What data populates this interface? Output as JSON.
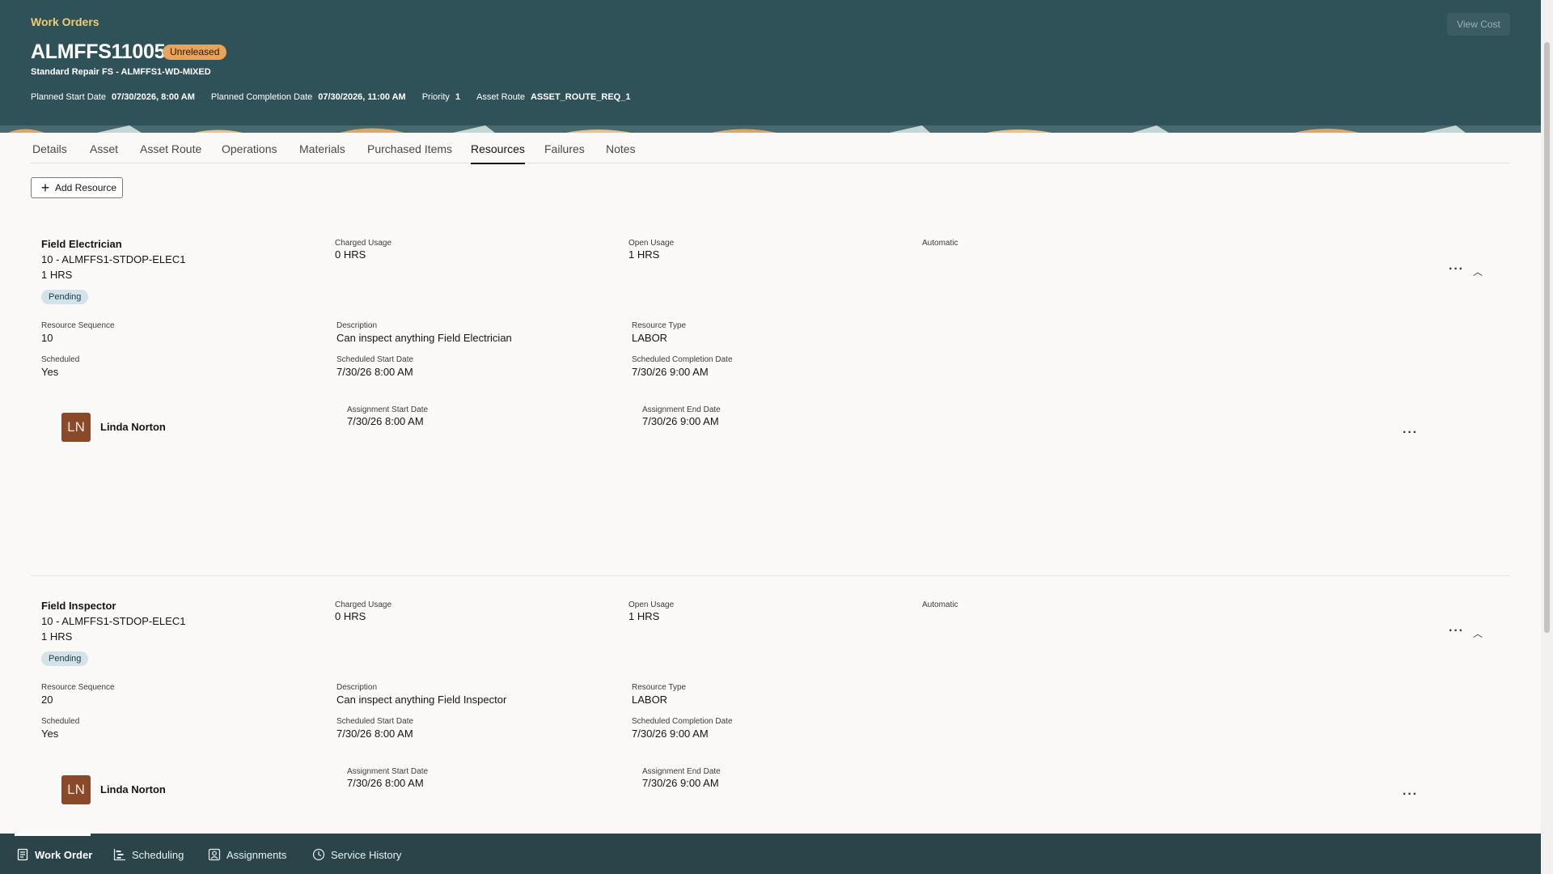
{
  "header": {
    "breadcrumb": "Work Orders",
    "title": "ALMFFS11005",
    "status": "Unreleased",
    "subtitle": "Standard Repair FS - ALMFFS1-WD-MIXED",
    "view_cost": "View Cost",
    "meta": [
      {
        "label": "Planned Start Date",
        "value": "07/30/2026, 8:00 AM"
      },
      {
        "label": "Planned Completion Date",
        "value": "07/30/2026, 11:00 AM"
      },
      {
        "label": "Priority",
        "value": "1"
      },
      {
        "label": "Asset Route",
        "value": "ASSET_ROUTE_REQ_1"
      }
    ]
  },
  "tabs": [
    "Details",
    "Asset",
    "Asset Route",
    "Operations",
    "Materials",
    "Purchased Items",
    "Resources",
    "Failures",
    "Notes"
  ],
  "active_tab": "Resources",
  "add_resource_label": "Add Resource",
  "resources": [
    {
      "name": "Field Electrician",
      "line1": "10 - ALMFFS1-STDOP-ELEC1",
      "line2": "1 HRS",
      "status": "Pending",
      "charged_usage_label": "Charged Usage",
      "charged_usage": "0 HRS",
      "open_usage_label": "Open Usage",
      "open_usage": "1 HRS",
      "automatic_label": "Automatic",
      "seq_label": "Resource Sequence",
      "seq": "10",
      "desc_label": "Description",
      "desc": "Can inspect anything Field Electrician",
      "type_label": "Resource Type",
      "type": "LABOR",
      "scheduled_label": "Scheduled",
      "scheduled": "Yes",
      "sched_start_label": "Scheduled Start Date",
      "sched_start": "7/30/26 8:00 AM",
      "sched_end_label": "Scheduled Completion Date",
      "sched_end": "7/30/26 9:00 AM",
      "assignee_initials": "LN",
      "assignee": "Linda Norton",
      "assign_start_label": "Assignment Start Date",
      "assign_start": "7/30/26 8:00 AM",
      "assign_end_label": "Assignment End Date",
      "assign_end": "7/30/26 9:00 AM"
    },
    {
      "name": "Field Inspector",
      "line1": "10 - ALMFFS1-STDOP-ELEC1",
      "line2": "1 HRS",
      "status": "Pending",
      "charged_usage_label": "Charged Usage",
      "charged_usage": "0 HRS",
      "open_usage_label": "Open Usage",
      "open_usage": "1 HRS",
      "automatic_label": "Automatic",
      "seq_label": "Resource Sequence",
      "seq": "20",
      "desc_label": "Description",
      "desc": "Can inspect anything Field Inspector",
      "type_label": "Resource Type",
      "type": "LABOR",
      "scheduled_label": "Scheduled",
      "scheduled": "Yes",
      "sched_start_label": "Scheduled Start Date",
      "sched_start": "7/30/26 8:00 AM",
      "sched_end_label": "Scheduled Completion Date",
      "sched_end": "7/30/26 9:00 AM",
      "assignee_initials": "LN",
      "assignee": "Linda Norton",
      "assign_start_label": "Assignment Start Date",
      "assign_start": "7/30/26 8:00 AM",
      "assign_end_label": "Assignment End Date",
      "assign_end": "7/30/26 9:00 AM"
    }
  ],
  "bottom_nav": [
    {
      "label": "Work Order",
      "icon": "document-icon"
    },
    {
      "label": "Scheduling",
      "icon": "gantt-icon"
    },
    {
      "label": "Assignments",
      "icon": "person-badge-icon"
    },
    {
      "label": "Service History",
      "icon": "clock-icon"
    }
  ],
  "colors": {
    "header_bg": "#2f5259",
    "breadcrumb": "#f0cc71",
    "status_badge": "#e9a35b",
    "pending_pill": "#d3e3ea",
    "avatar": "#8a4a2a",
    "bottom_nav_bg": "#2a4449"
  }
}
